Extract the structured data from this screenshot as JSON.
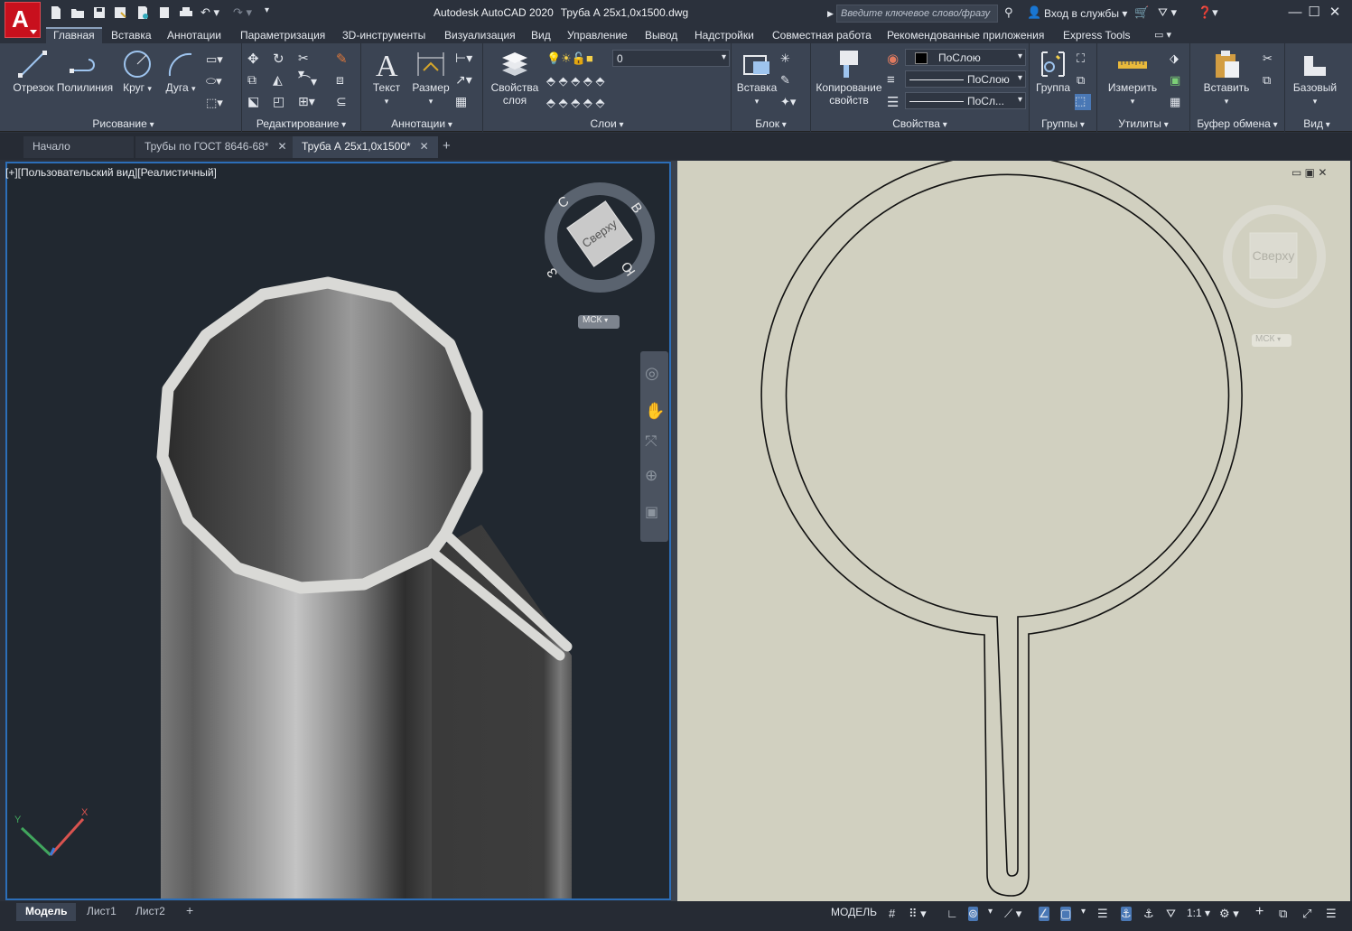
{
  "app": {
    "logo_letter": "A",
    "title": "Autodesk AutoCAD 2020",
    "filename": "Труба А 25х1,0х1500.dwg",
    "search_placeholder": "Введите ключевое слово/фразу",
    "signin": "Вход в службы"
  },
  "ribbon_tabs": [
    "Главная",
    "Вставка",
    "Аннотации",
    "Параметризация",
    "3D-инструменты",
    "Визуализация",
    "Вид",
    "Управление",
    "Вывод",
    "Надстройки",
    "Совместная работа",
    "Рекомендованные приложения",
    "Express Tools"
  ],
  "panels": {
    "draw": {
      "label": "Рисование",
      "line": "Отрезок",
      "polyline": "Полилиния",
      "circle": "Круг",
      "arc": "Дуга"
    },
    "modify": {
      "label": "Редактирование"
    },
    "annotation": {
      "label": "Аннотации",
      "text": "Текст",
      "dimension": "Размер"
    },
    "layers": {
      "label": "Слои",
      "layer_props_line1": "Свойства",
      "layer_props_line2": "слоя",
      "current_layer": "0"
    },
    "block": {
      "label": "Блок",
      "insert": "Вставка"
    },
    "properties": {
      "label": "Свойства",
      "match_line1": "Копирование",
      "match_line2": "свойств",
      "color": "ПоСлою",
      "linetype": "ПоСлою",
      "lineweight": "ПоСл..."
    },
    "groups": {
      "label": "Группы",
      "group": "Группа"
    },
    "utilities": {
      "label": "Утилиты",
      "measure": "Измерить"
    },
    "clipboard": {
      "label": "Буфер обмена",
      "paste": "Вставить"
    },
    "view": {
      "label": "Вид",
      "base": "Базовый"
    }
  },
  "doc_tabs": [
    {
      "label": "Начало",
      "closable": false,
      "active": false
    },
    {
      "label": "Трубы по ГОСТ 8646-68*",
      "closable": true,
      "active": false
    },
    {
      "label": "Труба А 25х1,0х1500*",
      "closable": true,
      "active": true
    }
  ],
  "viewport3d": {
    "label": "[+][Пользовательский вид][Реалистичный]",
    "viewcube_face": "Сверху",
    "compass": {
      "n": "С",
      "e": "В",
      "s": "Ю",
      "w": "З"
    },
    "ucs": "МСК"
  },
  "viewport2d": {
    "viewcube_face": "Сверху",
    "ucs": "МСК"
  },
  "layout_tabs": [
    "Модель",
    "Лист1",
    "Лист2"
  ],
  "status": {
    "model": "МОДЕЛЬ",
    "scale": "1:1"
  }
}
